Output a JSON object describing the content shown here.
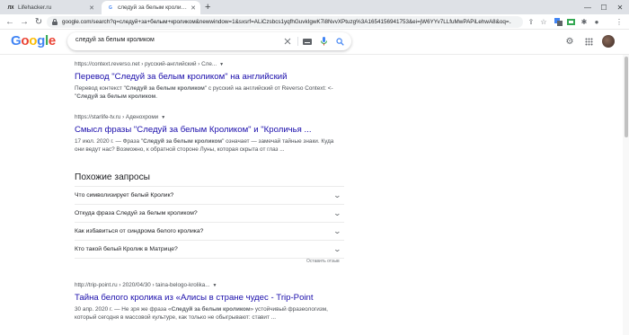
{
  "browser": {
    "tabs": [
      {
        "title": "Lifehacker.ru",
        "favicon": "ЛХ",
        "active": false
      },
      {
        "title": "следуй за белым кроликом - Поиск в Google",
        "favicon": "G",
        "active": true
      }
    ],
    "new_tab_symbol": "+",
    "url": "google.com/search?q=следуй+за+белым+кроликом&newwindow=1&sxsrf=ALiCzsbcs1yqfhGuvkIgwK7i8NvvXPtuzg%3A1654156941753&ei=jW6YYv7LLfuMwPAPiLehwA8&oq=..."
  },
  "google": {
    "logo_letters": [
      {
        "char": "G",
        "color": "#4285f4"
      },
      {
        "char": "o",
        "color": "#ea4335"
      },
      {
        "char": "o",
        "color": "#fbbc05"
      },
      {
        "char": "g",
        "color": "#4285f4"
      },
      {
        "char": "l",
        "color": "#34a853"
      },
      {
        "char": "e",
        "color": "#ea4335"
      }
    ],
    "query": "следуй за белым кроликом"
  },
  "results": [
    {
      "cite": "https://context.reverso.net › русский-английский › Сле...",
      "title": "Перевод \"Следуй за белым кроликом\" на английский",
      "snippet_html": "Перевод контекст \"<b>Следуй за белым кроликом</b>\" с русский на английский от Reverso Context: <- \"<b>Следуй за белым кроликом</b>."
    },
    {
      "cite": "https://starlife-tv.ru › Аденохроми",
      "title": "Смысл фразы \"Следуй за белым Кроликом\" и \"Кроличья ...",
      "snippet_html": "17 июл. 2020 г. — Фраза \"<b>Следуй за белым кроликом</b>\" означает — замечай тайные знаки. Куда они ведут нас? Возможно, к обратной стороне Луны, которая скрыта от глаз ..."
    },
    {
      "cite": "http://trip-point.ru › 2020/04/30 › taina-belogo-krolika...",
      "title": "Тайна белого кролика из «Алисы в стране чудес - Trip-Point",
      "snippet_html": "30 апр. 2020 г. — Не зря же фраза «<b>Следуй за белым кроликом</b>» устойчивый фразеологизм, который сегодня в массовой культуре, как только не обыгрывают: ставит ..."
    }
  ],
  "people_also_ask": {
    "title": "Похожие запросы",
    "questions": [
      "Что символизирует белый Кролик?",
      "Откуда фраза Следуй за белым кроликом?",
      "Как избавиться от синдрома белого кролика?",
      "Кто такой белый Кролик в Матрице?"
    ],
    "feedback": "Оставить отзыв"
  }
}
